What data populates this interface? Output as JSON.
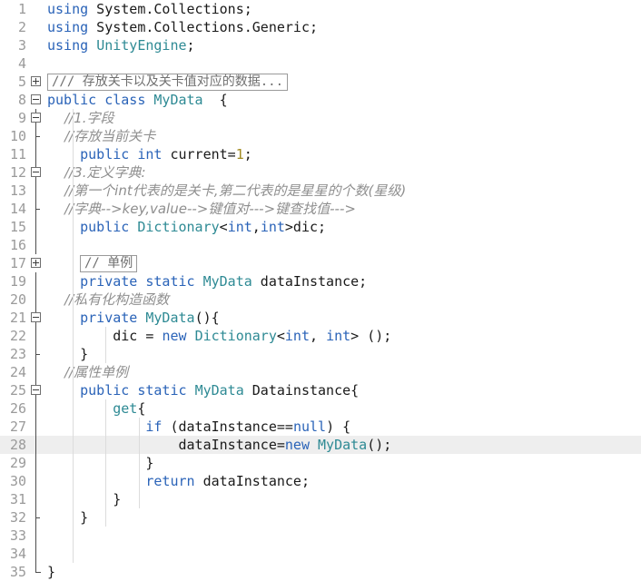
{
  "editor": {
    "language": "csharp",
    "current_line": 28,
    "colors": {
      "background": "#ffffff",
      "current_line_highlight": "#eeeeee",
      "gutter_text": "#9a9a9a",
      "keyword": "#2a63b8",
      "type": "#2e8a94",
      "number": "#a08a20",
      "comment": "#8f8f8f",
      "plain": "#1a1a1a",
      "indent_guide": "#dcdcdc",
      "fold_marker": "#6e6e6e"
    },
    "lines": [
      {
        "number": "1",
        "fold": "none",
        "indent_guides": [],
        "tokens": [
          {
            "t": "using",
            "c": "kw"
          },
          {
            "t": " System.Collections;",
            "c": "pln"
          }
        ]
      },
      {
        "number": "2",
        "fold": "none",
        "indent_guides": [],
        "tokens": [
          {
            "t": "using",
            "c": "kw"
          },
          {
            "t": " System.Collections.Generic;",
            "c": "pln"
          }
        ]
      },
      {
        "number": "3",
        "fold": "none",
        "indent_guides": [],
        "tokens": [
          {
            "t": "using",
            "c": "kw"
          },
          {
            "t": " ",
            "c": "pln"
          },
          {
            "t": "UnityEngine",
            "c": "type"
          },
          {
            "t": ";",
            "c": "pln"
          }
        ]
      },
      {
        "number": "4",
        "fold": "none",
        "indent_guides": [],
        "tokens": []
      },
      {
        "number": "5",
        "fold": "plus",
        "indent_guides": [],
        "folded_text": "/// 存放关卡以及关卡值对应的数据...",
        "tokens": []
      },
      {
        "number": "8",
        "fold": "minus",
        "indent_guides": [],
        "tokens": [
          {
            "t": "public",
            "c": "kw"
          },
          {
            "t": " ",
            "c": "pln"
          },
          {
            "t": "class",
            "c": "kw"
          },
          {
            "t": " ",
            "c": "pln"
          },
          {
            "t": "MyData",
            "c": "type"
          },
          {
            "t": "  {",
            "c": "pln"
          }
        ]
      },
      {
        "number": "9",
        "fold": "minus-nested",
        "indent_guides": [
          1
        ],
        "tokens": [
          {
            "t": "    //1.字段",
            "c": "cmt"
          }
        ]
      },
      {
        "number": "10",
        "fold": "tick",
        "indent_guides": [
          1
        ],
        "tokens": [
          {
            "t": "    //存放当前关卡",
            "c": "cmt"
          }
        ]
      },
      {
        "number": "11",
        "fold": "line",
        "indent_guides": [
          1
        ],
        "tokens": [
          {
            "t": "    ",
            "c": "pln"
          },
          {
            "t": "public",
            "c": "kw"
          },
          {
            "t": " ",
            "c": "pln"
          },
          {
            "t": "int",
            "c": "kw"
          },
          {
            "t": " current=",
            "c": "pln"
          },
          {
            "t": "1",
            "c": "num"
          },
          {
            "t": ";",
            "c": "pln"
          }
        ]
      },
      {
        "number": "12",
        "fold": "minus-nested",
        "indent_guides": [
          1
        ],
        "tokens": [
          {
            "t": "    //3.定义字典:",
            "c": "cmt"
          }
        ]
      },
      {
        "number": "13",
        "fold": "line",
        "indent_guides": [
          1
        ],
        "tokens": [
          {
            "t": "    //第一个int代表的是关卡,第二代表的是星星的个数(星级)",
            "c": "cmt"
          }
        ]
      },
      {
        "number": "14",
        "fold": "tick",
        "indent_guides": [
          1
        ],
        "tokens": [
          {
            "t": "    //字典-->key,value-->键值对--->键查找值--->",
            "c": "cmt"
          }
        ]
      },
      {
        "number": "15",
        "fold": "line",
        "indent_guides": [
          1
        ],
        "tokens": [
          {
            "t": "    ",
            "c": "pln"
          },
          {
            "t": "public",
            "c": "kw"
          },
          {
            "t": " ",
            "c": "pln"
          },
          {
            "t": "Dictionary",
            "c": "type"
          },
          {
            "t": "<",
            "c": "pln"
          },
          {
            "t": "int",
            "c": "kw"
          },
          {
            "t": ",",
            "c": "pln"
          },
          {
            "t": "int",
            "c": "kw"
          },
          {
            "t": ">dic;",
            "c": "pln"
          }
        ]
      },
      {
        "number": "16",
        "fold": "line",
        "indent_guides": [
          1
        ],
        "tokens": []
      },
      {
        "number": "17",
        "fold": "plus",
        "indent_guides": [
          1
        ],
        "folded_text": "// 单例",
        "tokens": []
      },
      {
        "number": "19",
        "fold": "line",
        "indent_guides": [
          1
        ],
        "tokens": [
          {
            "t": "    ",
            "c": "pln"
          },
          {
            "t": "private",
            "c": "kw"
          },
          {
            "t": " ",
            "c": "pln"
          },
          {
            "t": "static",
            "c": "kw"
          },
          {
            "t": " ",
            "c": "pln"
          },
          {
            "t": "MyData",
            "c": "type"
          },
          {
            "t": " dataInstance;",
            "c": "pln"
          }
        ]
      },
      {
        "number": "20",
        "fold": "line",
        "indent_guides": [
          1
        ],
        "tokens": [
          {
            "t": "    //私有化构造函数",
            "c": "cmt"
          }
        ]
      },
      {
        "number": "21",
        "fold": "minus-nested",
        "indent_guides": [
          1
        ],
        "tokens": [
          {
            "t": "    ",
            "c": "pln"
          },
          {
            "t": "private",
            "c": "kw"
          },
          {
            "t": " ",
            "c": "pln"
          },
          {
            "t": "MyData",
            "c": "type"
          },
          {
            "t": "(){",
            "c": "pln"
          }
        ]
      },
      {
        "number": "22",
        "fold": "line",
        "indent_guides": [
          1,
          2
        ],
        "tokens": [
          {
            "t": "        dic = ",
            "c": "pln"
          },
          {
            "t": "new",
            "c": "kw"
          },
          {
            "t": " ",
            "c": "pln"
          },
          {
            "t": "Dictionary",
            "c": "type"
          },
          {
            "t": "<",
            "c": "pln"
          },
          {
            "t": "int",
            "c": "kw"
          },
          {
            "t": ", ",
            "c": "pln"
          },
          {
            "t": "int",
            "c": "kw"
          },
          {
            "t": "> ();",
            "c": "pln"
          }
        ]
      },
      {
        "number": "23",
        "fold": "tick",
        "indent_guides": [
          1,
          2
        ],
        "tokens": [
          {
            "t": "    }",
            "c": "pln"
          }
        ]
      },
      {
        "number": "24",
        "fold": "line",
        "indent_guides": [
          1
        ],
        "tokens": [
          {
            "t": "    //属性单例",
            "c": "cmt"
          }
        ]
      },
      {
        "number": "25",
        "fold": "minus-nested",
        "indent_guides": [
          1
        ],
        "tokens": [
          {
            "t": "    ",
            "c": "pln"
          },
          {
            "t": "public",
            "c": "kw"
          },
          {
            "t": " ",
            "c": "pln"
          },
          {
            "t": "static",
            "c": "kw"
          },
          {
            "t": " ",
            "c": "pln"
          },
          {
            "t": "MyData",
            "c": "type"
          },
          {
            "t": " Datainstance{",
            "c": "pln"
          }
        ]
      },
      {
        "number": "26",
        "fold": "line",
        "indent_guides": [
          1,
          2
        ],
        "tokens": [
          {
            "t": "        ",
            "c": "pln"
          },
          {
            "t": "get",
            "c": "type"
          },
          {
            "t": "{",
            "c": "pln"
          }
        ]
      },
      {
        "number": "27",
        "fold": "line",
        "indent_guides": [
          1,
          2,
          3
        ],
        "tokens": [
          {
            "t": "            ",
            "c": "pln"
          },
          {
            "t": "if",
            "c": "kw"
          },
          {
            "t": " (dataInstance==",
            "c": "pln"
          },
          {
            "t": "null",
            "c": "kw"
          },
          {
            "t": ") {",
            "c": "pln"
          }
        ]
      },
      {
        "number": "28",
        "fold": "line",
        "current": true,
        "indent_guides": [
          1,
          2,
          3
        ],
        "tokens": [
          {
            "t": "                dataInstance=",
            "c": "pln"
          },
          {
            "t": "new",
            "c": "kw"
          },
          {
            "t": " ",
            "c": "pln"
          },
          {
            "t": "MyData",
            "c": "type"
          },
          {
            "t": "();",
            "c": "pln"
          }
        ]
      },
      {
        "number": "29",
        "fold": "line",
        "indent_guides": [
          1,
          2,
          3
        ],
        "tokens": [
          {
            "t": "            }",
            "c": "pln"
          }
        ]
      },
      {
        "number": "30",
        "fold": "line",
        "indent_guides": [
          1,
          2,
          3
        ],
        "tokens": [
          {
            "t": "            ",
            "c": "pln"
          },
          {
            "t": "return",
            "c": "kw"
          },
          {
            "t": " dataInstance;",
            "c": "pln"
          }
        ]
      },
      {
        "number": "31",
        "fold": "line",
        "indent_guides": [
          1,
          2,
          3
        ],
        "tokens": [
          {
            "t": "        }",
            "c": "pln"
          }
        ]
      },
      {
        "number": "32",
        "fold": "tick",
        "indent_guides": [
          1,
          2
        ],
        "tokens": [
          {
            "t": "    }",
            "c": "pln"
          }
        ]
      },
      {
        "number": "33",
        "fold": "line",
        "indent_guides": [
          1
        ],
        "tokens": []
      },
      {
        "number": "34",
        "fold": "line",
        "indent_guides": [
          1
        ],
        "tokens": []
      },
      {
        "number": "35",
        "fold": "end",
        "indent_guides": [],
        "tokens": [
          {
            "t": "}",
            "c": "pln"
          }
        ]
      }
    ]
  }
}
